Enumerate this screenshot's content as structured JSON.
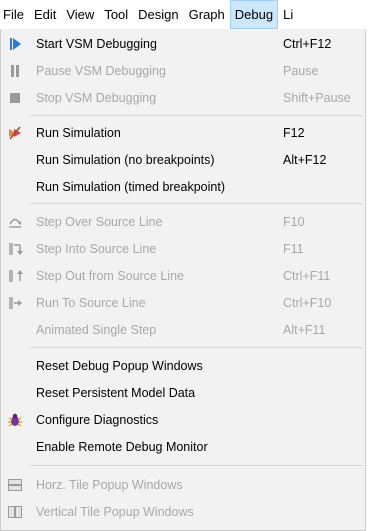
{
  "menubar": {
    "items": [
      "File",
      "Edit",
      "View",
      "Tool",
      "Design",
      "Graph",
      "Debug",
      "Li"
    ],
    "active": "Debug"
  },
  "debug_menu": {
    "items": [
      {
        "label": "Start VSM Debugging",
        "shortcut": "Ctrl+F12",
        "enabled": true,
        "icon": "play-arrow-icon"
      },
      {
        "label": "Pause VSM Debugging",
        "shortcut": "Pause",
        "enabled": false,
        "icon": "pause-icon"
      },
      {
        "label": "Stop VSM Debugging",
        "shortcut": "Shift+Pause",
        "enabled": false,
        "icon": "stop-icon"
      },
      {
        "label": "Run Simulation",
        "shortcut": "F12",
        "enabled": true,
        "icon": "run-simulation-icon"
      },
      {
        "label": "Run Simulation (no breakpoints)",
        "shortcut": "Alt+F12",
        "enabled": true,
        "icon": ""
      },
      {
        "label": "Run Simulation (timed breakpoint)",
        "shortcut": "",
        "enabled": true,
        "icon": ""
      },
      {
        "label": "Step Over Source Line",
        "shortcut": "F10",
        "enabled": false,
        "icon": "step-over-icon"
      },
      {
        "label": "Step Into Source Line",
        "shortcut": "F11",
        "enabled": false,
        "icon": "step-into-icon"
      },
      {
        "label": "Step Out from Source Line",
        "shortcut": "Ctrl+F11",
        "enabled": false,
        "icon": "step-out-icon"
      },
      {
        "label": "Run To Source Line",
        "shortcut": "Ctrl+F10",
        "enabled": false,
        "icon": "run-to-line-icon"
      },
      {
        "label": "Animated Single Step",
        "shortcut": "Alt+F11",
        "enabled": false,
        "icon": ""
      },
      {
        "label": "Reset Debug Popup Windows",
        "shortcut": "",
        "enabled": true,
        "icon": ""
      },
      {
        "label": "Reset Persistent Model Data",
        "shortcut": "",
        "enabled": true,
        "icon": ""
      },
      {
        "label": "Configure Diagnostics",
        "shortcut": "",
        "enabled": true,
        "icon": "bug-icon"
      },
      {
        "label": "Enable Remote Debug Monitor",
        "shortcut": "",
        "enabled": true,
        "icon": ""
      },
      {
        "label": "Horz. Tile Popup Windows",
        "shortcut": "",
        "enabled": false,
        "icon": "horizontal-tile-icon"
      },
      {
        "label": "Vertical Tile Popup Windows",
        "shortcut": "",
        "enabled": false,
        "icon": "vertical-tile-icon"
      }
    ]
  },
  "colors": {
    "menu_bg": "#f2f2f2",
    "active_menu_bg": "#cce8ff",
    "disabled_text": "#a8a8a8",
    "play_icon": "#2a7ad5",
    "bug_icon": "#7a2fa0"
  }
}
